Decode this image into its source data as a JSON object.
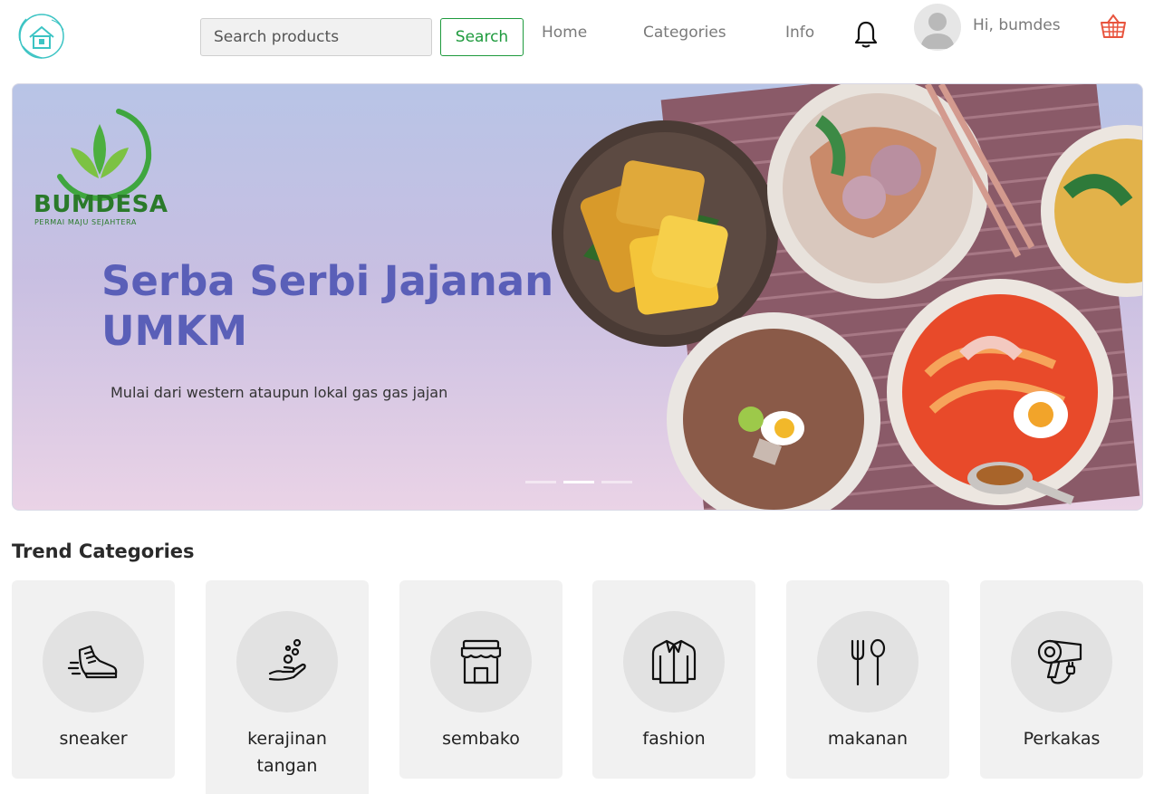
{
  "header": {
    "logo_icon": "bumdes-house-logo-icon",
    "search": {
      "placeholder": "Search products",
      "value": ""
    },
    "search_button_label": "Search",
    "nav": [
      {
        "label": "Home"
      },
      {
        "label": "Categories"
      },
      {
        "label": "Info"
      }
    ],
    "notification_icon": "bell-icon",
    "user_greeting": "Hi, bumdes",
    "cart_icon": "basket-icon",
    "accent_color": "#1e9a3d"
  },
  "banner": {
    "brand_name": "BUMDESA",
    "brand_tagline": "PERMAI MAJU SEJAHTERA",
    "title_line1": "Serba Serbi Jajanan",
    "title_line2": "UMKM",
    "subtitle": "Mulai dari western ataupun lokal gas gas jajan",
    "slides_count": 3,
    "active_slide": 2,
    "title_color": "#5a5fb8"
  },
  "categories": {
    "title": "Trend Categories",
    "items": [
      {
        "label": "sneaker",
        "icon": "sneaker-icon"
      },
      {
        "label": "kerajinan tangan",
        "icon": "handcraft-icon"
      },
      {
        "label": "sembako",
        "icon": "store-icon"
      },
      {
        "label": "fashion",
        "icon": "jacket-icon"
      },
      {
        "label": "makanan",
        "icon": "fork-spoon-icon"
      },
      {
        "label": "Perkakas",
        "icon": "hair-dryer-icon"
      }
    ]
  }
}
